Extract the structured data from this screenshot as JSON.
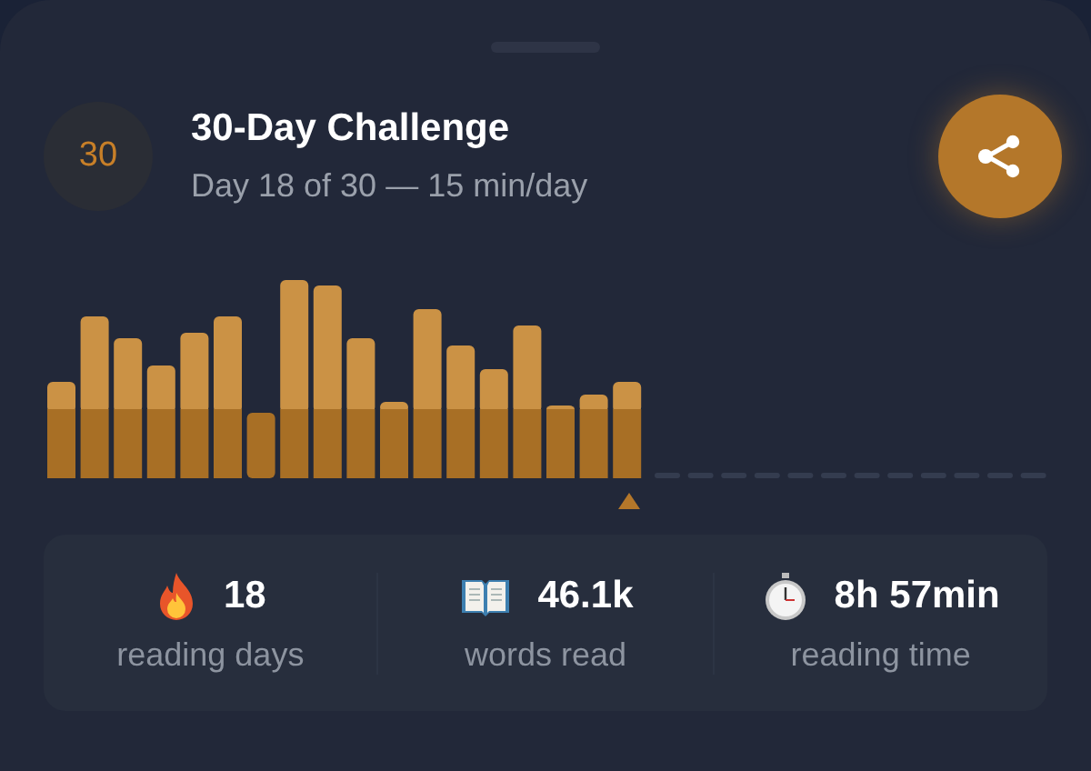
{
  "header": {
    "badge": "30",
    "title": "30-Day Challenge",
    "subtitle": "Day 18 of 30 — 15 min/day"
  },
  "stats": [
    {
      "value": "18",
      "label": "reading days"
    },
    {
      "value": "46.1k",
      "label": "words read"
    },
    {
      "value": "8h 57min",
      "label": "reading time"
    }
  ]
}
